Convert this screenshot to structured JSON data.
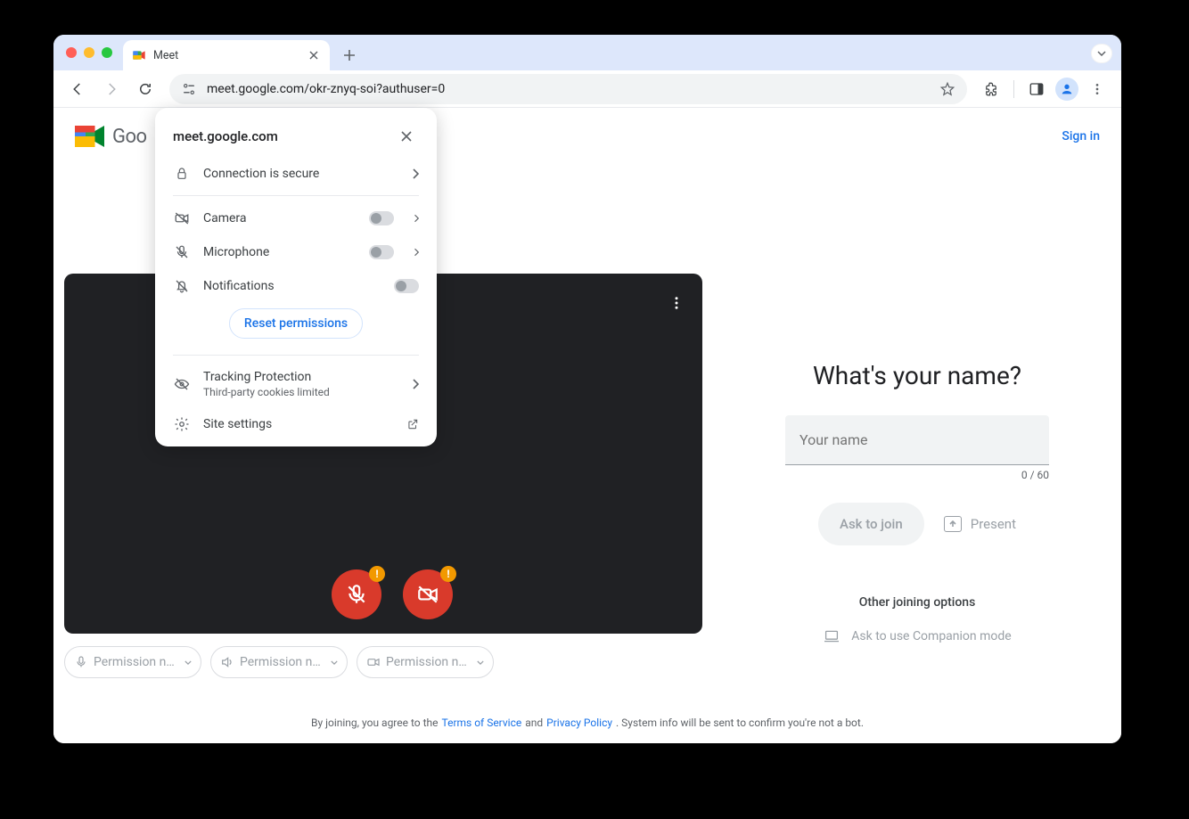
{
  "browser": {
    "tab_title": "Meet",
    "url": "meet.google.com/okr-znyq-soi?authuser=0"
  },
  "header": {
    "logo_text": "Goo",
    "sign_in": "Sign in"
  },
  "preview": {
    "permission_chips": [
      "Permission ne…",
      "Permission ne…",
      "Permission ne…"
    ]
  },
  "right": {
    "heading": "What's your name?",
    "name_placeholder": "Your name",
    "name_value": "",
    "counter": "0 / 60",
    "ask_to_join": "Ask to join",
    "present": "Present",
    "other_options": "Other joining options",
    "companion": "Ask to use Companion mode"
  },
  "footer": {
    "pre": "By joining, you agree to the",
    "tos": "Terms of Service",
    "and": "and",
    "privacy": "Privacy Policy",
    "post": ". System info will be sent to confirm you're not a bot."
  },
  "popover": {
    "domain": "meet.google.com",
    "secure": "Connection is secure",
    "camera": "Camera",
    "microphone": "Microphone",
    "notifications": "Notifications",
    "reset": "Reset permissions",
    "tracking_title": "Tracking Protection",
    "tracking_sub": "Third-party cookies limited",
    "site_settings": "Site settings"
  }
}
